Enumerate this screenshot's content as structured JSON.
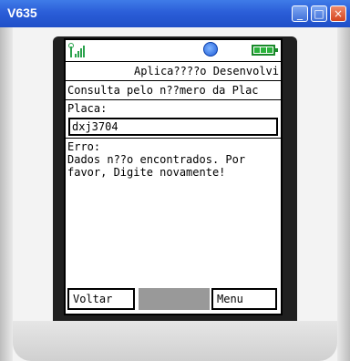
{
  "window": {
    "title": "V635",
    "minimize_glyph": "_",
    "maximize_glyph": "□",
    "close_glyph": "×"
  },
  "statusbar": {
    "signal_icon": "signal-strength-icon",
    "network_icon": "globe-icon",
    "battery_icon": "battery-full-icon"
  },
  "screen": {
    "app_title": "Aplica????o Desenvolvi",
    "subtitle": "Consulta pelo n??mero da Plac",
    "plate_label": "Placa:",
    "plate_value": "dxj3704",
    "error_title": "Erro:",
    "error_message": "Dados n??o encontrados. Por favor, Digite novamente!"
  },
  "softkeys": {
    "left": "Voltar",
    "middle": "",
    "right": "Menu"
  },
  "colors": {
    "titlebar": "#2b5ed8",
    "signal": "#2aa24c",
    "battery": "#2bb33c"
  }
}
